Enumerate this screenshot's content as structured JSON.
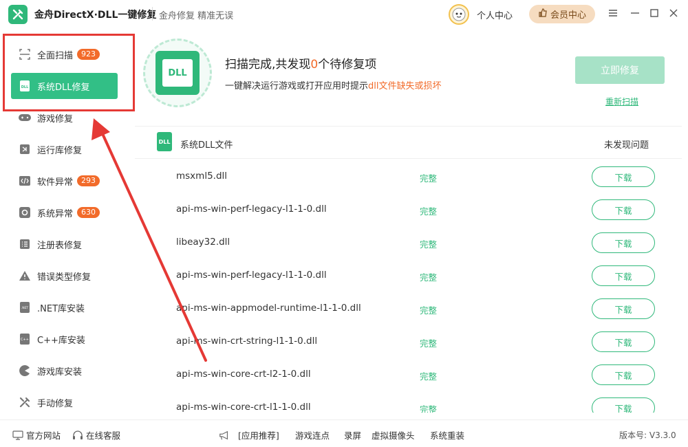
{
  "titlebar": {
    "title": "金舟DirectX·DLL一键修复",
    "slogan": "金舟修复 精准无误",
    "personal_center": "个人中心",
    "vip_center": "会员中心"
  },
  "sidebar": {
    "items": [
      {
        "label": "全面扫描",
        "badge": "923",
        "icon": "scan-icon"
      },
      {
        "label": "系统DLL修复",
        "badge": "",
        "icon": "dll-icon",
        "active": true
      },
      {
        "label": "游戏修复",
        "badge": "",
        "icon": "gamepad-icon"
      },
      {
        "label": "运行库修复",
        "badge": "",
        "icon": "runtime-icon"
      },
      {
        "label": "软件异常",
        "badge": "293",
        "icon": "code-icon"
      },
      {
        "label": "系统异常",
        "badge": "630",
        "icon": "gear-icon"
      },
      {
        "label": "注册表修复",
        "badge": "",
        "icon": "list-icon"
      },
      {
        "label": "错误类型修复",
        "badge": "",
        "icon": "warning-icon"
      },
      {
        "label": ".NET库安装",
        "badge": "",
        "icon": "dotnet-icon"
      },
      {
        "label": "C++库安装",
        "badge": "",
        "icon": "cpp-icon"
      },
      {
        "label": "游戏库安装",
        "badge": "",
        "icon": "pacman-icon"
      },
      {
        "label": "手动修复",
        "badge": "",
        "icon": "tools-icon"
      }
    ]
  },
  "summary": {
    "title_prefix": "扫描完成,共发现",
    "count": "0",
    "title_suffix": "个待修复项",
    "desc_prefix": "一键解决运行游戏或打开应用时提示",
    "desc_highlight": "dll文件缺失或损坏",
    "repair_button": "立即修复",
    "rescan_link": "重新扫描",
    "dll_badge_text": "DLL"
  },
  "table": {
    "header_icon_text": "DLL",
    "header_title": "系统DLL文件",
    "header_status": "未发现问题",
    "rows": [
      {
        "name": "msxml5.dll",
        "status": "完整",
        "action": "下载"
      },
      {
        "name": "api-ms-win-perf-legacy-l1-1-0.dll",
        "status": "完整",
        "action": "下载"
      },
      {
        "name": "libeay32.dll",
        "status": "完整",
        "action": "下载"
      },
      {
        "name": "api-ms-win-perf-legacy-l1-1-0.dll",
        "status": "完整",
        "action": "下载"
      },
      {
        "name": "api-ms-win-appmodel-runtime-l1-1-0.dll",
        "status": "完整",
        "action": "下载"
      },
      {
        "name": "api-ms-win-crt-string-l1-1-0.dll",
        "status": "完整",
        "action": "下载"
      },
      {
        "name": "api-ms-win-core-crt-l2-1-0.dll",
        "status": "完整",
        "action": "下载"
      },
      {
        "name": "api-ms-win-core-crt-l1-1-0.dll",
        "status": "完整",
        "action": "下载"
      }
    ]
  },
  "footer": {
    "official_site": "官方网站",
    "online_service": "在线客服",
    "app_recommend": "[应用推荐]",
    "links": [
      "游戏连点",
      "录屏",
      "虚拟摄像头",
      "系统重装"
    ],
    "version": "版本号: V3.3.0"
  },
  "colors": {
    "accent": "#32bf86",
    "badge": "#f26b2a",
    "annotation": "#e53935"
  }
}
